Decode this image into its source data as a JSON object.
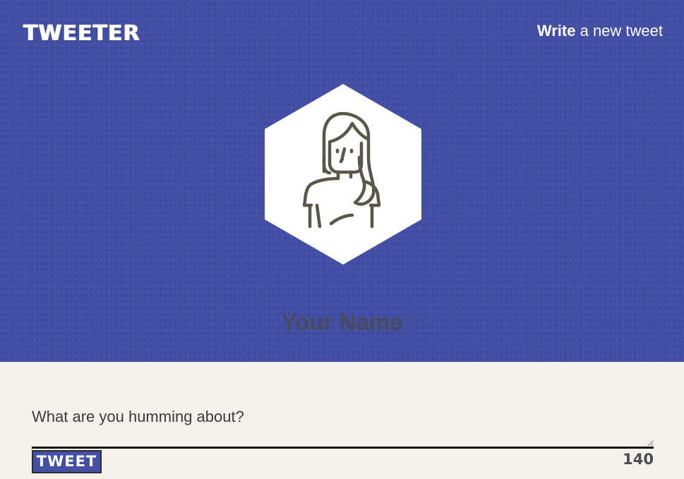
{
  "header": {
    "brand": "TWEETER",
    "nav_link": {
      "strong": "Write",
      "rest": "a new tweet"
    }
  },
  "profile": {
    "avatar_icon": "woman-avatar-icon",
    "name": "Your Name"
  },
  "composer": {
    "placeholder": "What are you humming about?",
    "value": "",
    "button_label": "TWEET",
    "char_counter": "140"
  },
  "colors": {
    "hero_background": "#4350a6",
    "page_background": "#f4f1ec",
    "avatar_stroke": "#5b5648",
    "text_dark": "#4a4a52"
  }
}
